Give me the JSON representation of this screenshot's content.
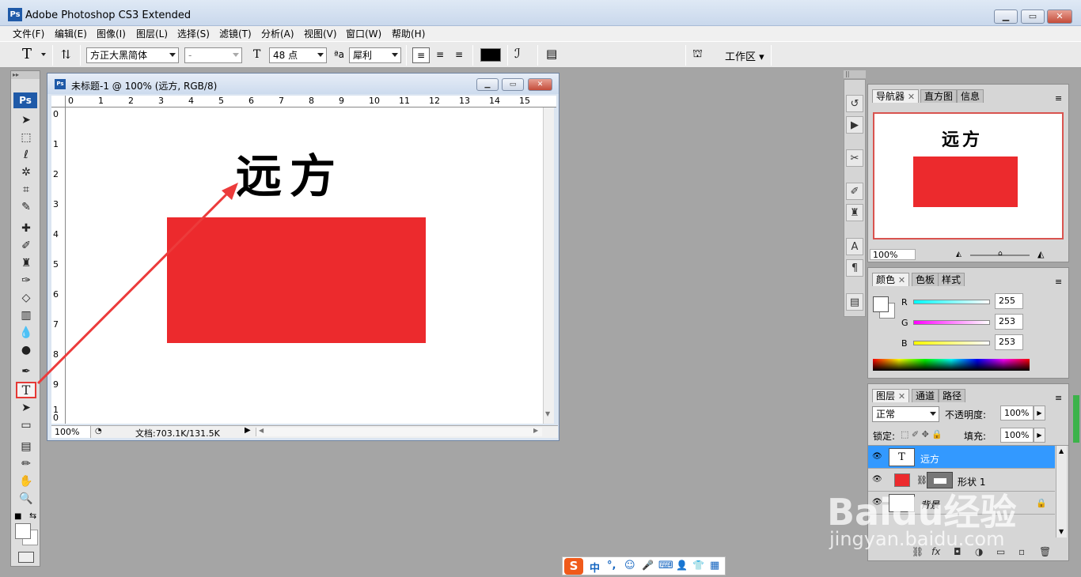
{
  "app": {
    "title": "Adobe Photoshop CS3 Extended",
    "logo": "Ps"
  },
  "window_controls": {
    "minimize": "▁",
    "restore": "▭",
    "close": "✕"
  },
  "menu": [
    "文件(F)",
    "编辑(E)",
    "图像(I)",
    "图层(L)",
    "选择(S)",
    "滤镜(T)",
    "分析(A)",
    "视图(V)",
    "窗口(W)",
    "帮助(H)"
  ],
  "options": {
    "tool_glyph": "T",
    "font_family": "方正大黑简体",
    "font_style": "-",
    "font_size": "48 点",
    "antialias": "犀利",
    "workspace": "工作区"
  },
  "document": {
    "title": "未标题-1 @ 100% (远方, RGB/8)",
    "zoom": "100%",
    "doc_info": "文档:703.1K/131.5K",
    "text_layer_content": "远方",
    "shape_color": "#ec2a2d",
    "ruler_h": [
      "0",
      "1",
      "2",
      "3",
      "4",
      "5",
      "6",
      "7",
      "8",
      "9",
      "10",
      "11",
      "12",
      "13",
      "14",
      "15"
    ],
    "ruler_v": [
      "0",
      "1",
      "2",
      "3",
      "4",
      "5",
      "6",
      "7",
      "8",
      "9",
      "1 0"
    ]
  },
  "navigator": {
    "tabs": [
      "导航器",
      "直方图",
      "信息"
    ],
    "preview_text": "远方",
    "zoom": "100%"
  },
  "color": {
    "tabs": [
      "颜色",
      "色板",
      "样式"
    ],
    "channels": [
      {
        "label": "R",
        "value": "255"
      },
      {
        "label": "G",
        "value": "253"
      },
      {
        "label": "B",
        "value": "253"
      }
    ]
  },
  "layers": {
    "tabs": [
      "图层",
      "通道",
      "路径"
    ],
    "blend_mode": "正常",
    "opacity_label": "不透明度:",
    "opacity": "100%",
    "lock_label": "锁定:",
    "fill_label": "填充:",
    "fill": "100%",
    "items": [
      {
        "name": "远方",
        "thumb": "T"
      },
      {
        "name": "形状 1",
        "thumb": ""
      },
      {
        "name": "背景",
        "thumb": ""
      }
    ]
  },
  "ime": {
    "logo": "S",
    "items": [
      "中",
      "°,",
      "☺",
      "🎤",
      "⌨",
      "👤",
      "👕",
      "▦"
    ]
  },
  "watermark": {
    "text": "Baidu经验",
    "url": "jingyan.baidu.com"
  }
}
